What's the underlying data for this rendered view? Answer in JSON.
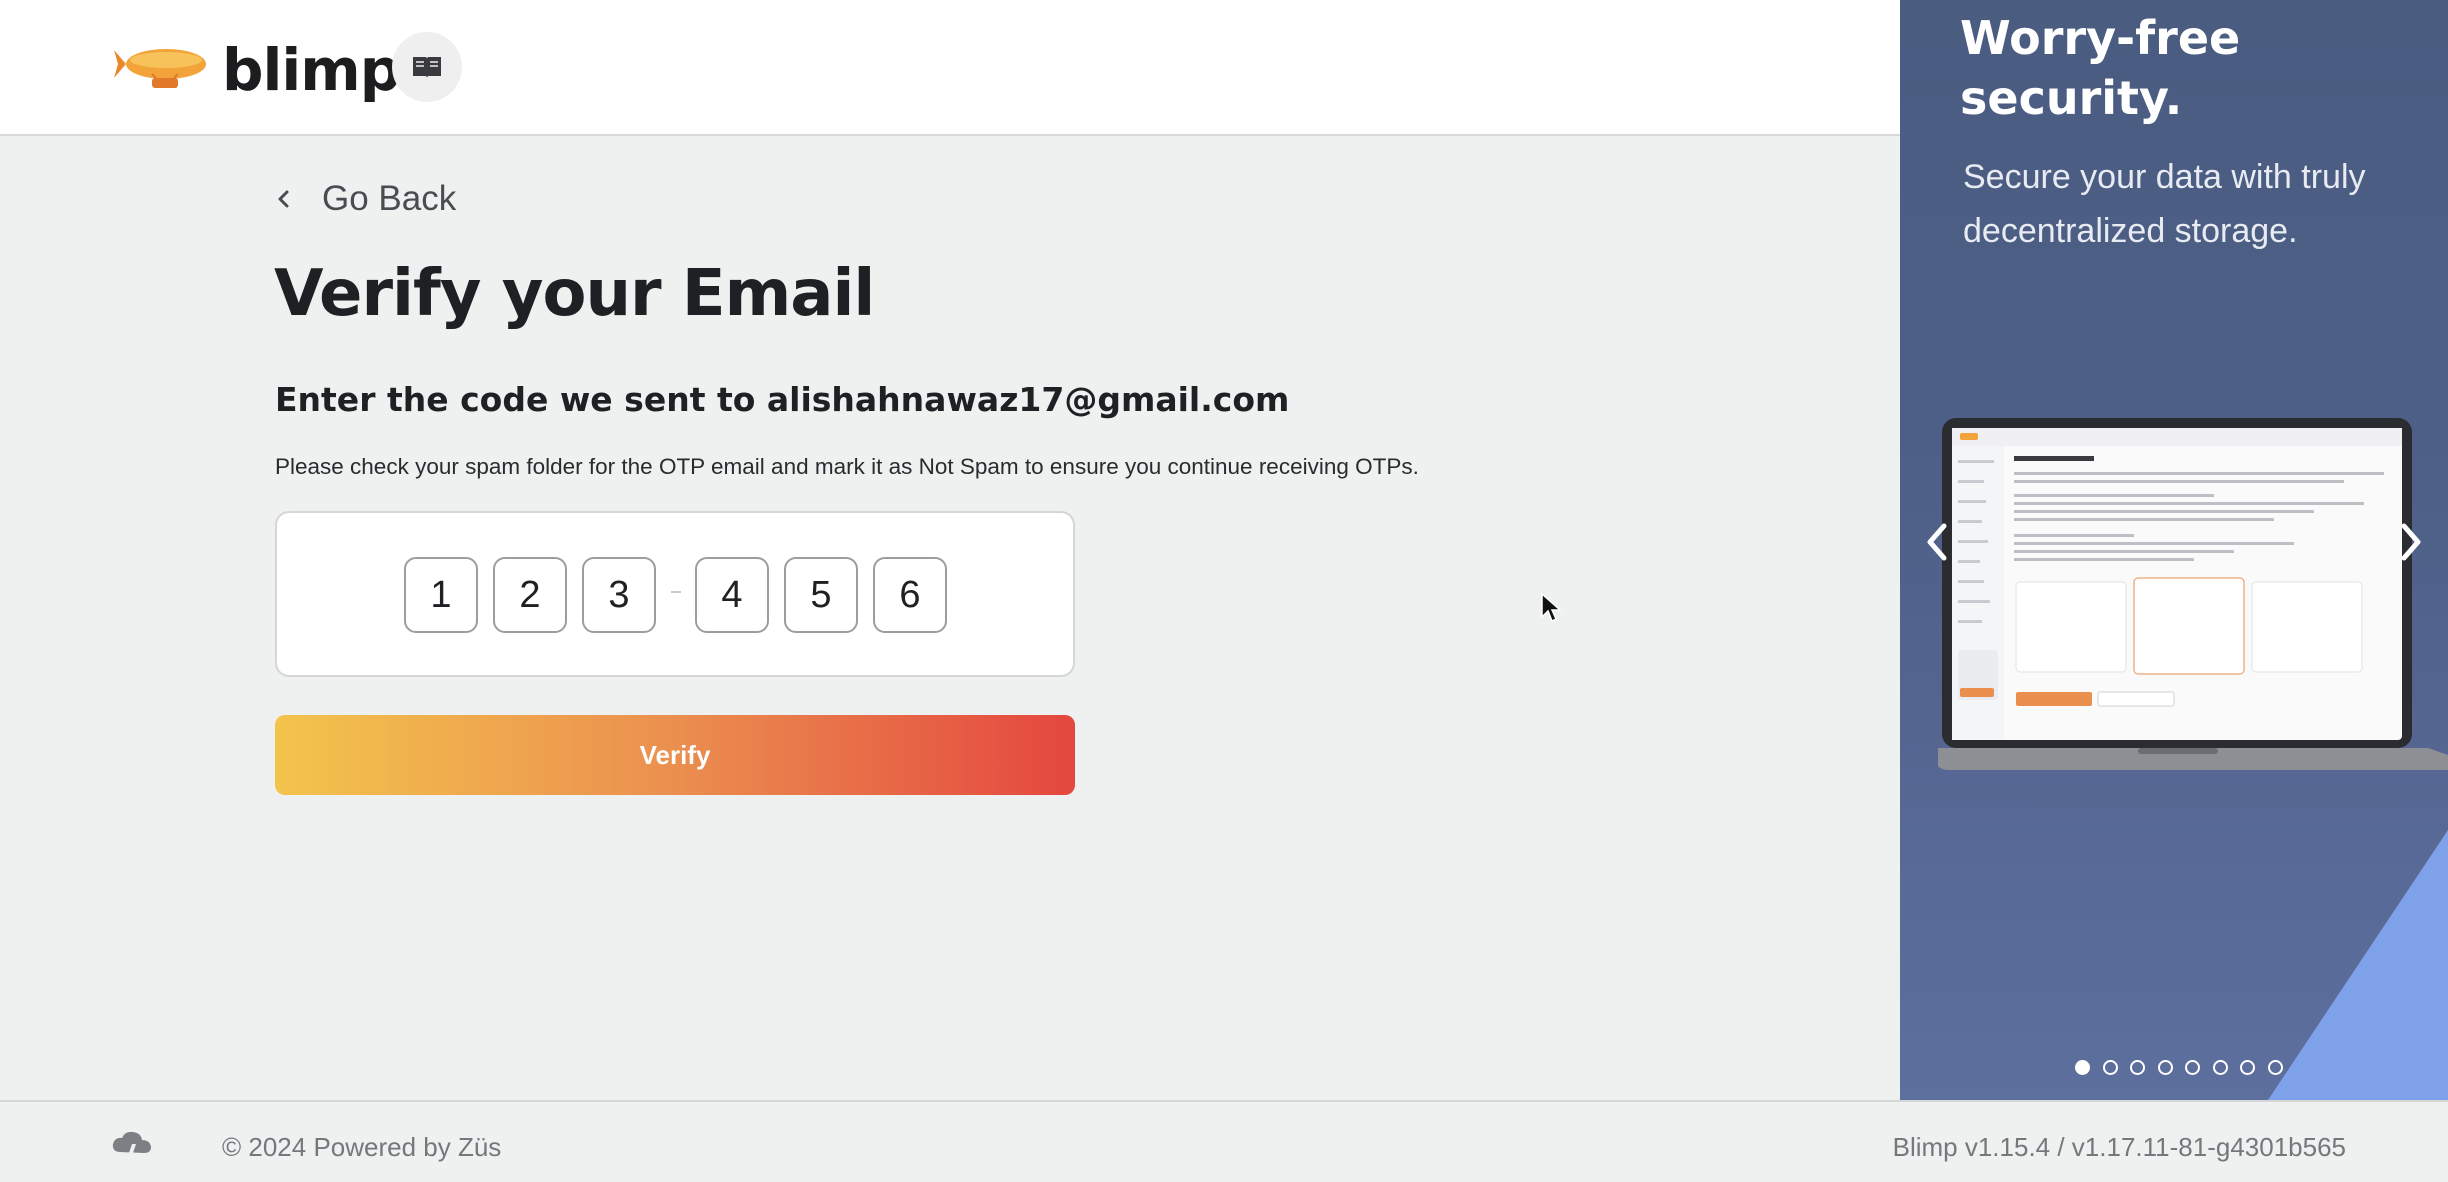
{
  "header": {
    "brand": "blimp",
    "docs_icon": "book-icon"
  },
  "form": {
    "go_back": "Go Back",
    "title": "Verify your Email",
    "subtitle": "Enter the code we sent to alishahnawaz17@gmail.com",
    "note": "Please check your spam folder for the OTP email and mark it as Not Spam to ensure you continue receiving OTPs.",
    "otp": [
      "1",
      "2",
      "3",
      "4",
      "5",
      "6"
    ],
    "verify_label": "Verify"
  },
  "promo": {
    "title": "Worry-free security.",
    "text": "Secure your data with truly decentralized storage.",
    "slide_count": 8,
    "active_slide": 1,
    "accent_color": "#7ea1ea"
  },
  "footer": {
    "copyright": "© 2024 Powered by Züs",
    "version": "Blimp v1.15.4 / v1.17.11-81-g4301b565"
  },
  "colors": {
    "verify_gradient": [
      "#f3c44c",
      "#eb8f4f",
      "#e4473f"
    ],
    "promo_bg": "#4d5f86"
  }
}
